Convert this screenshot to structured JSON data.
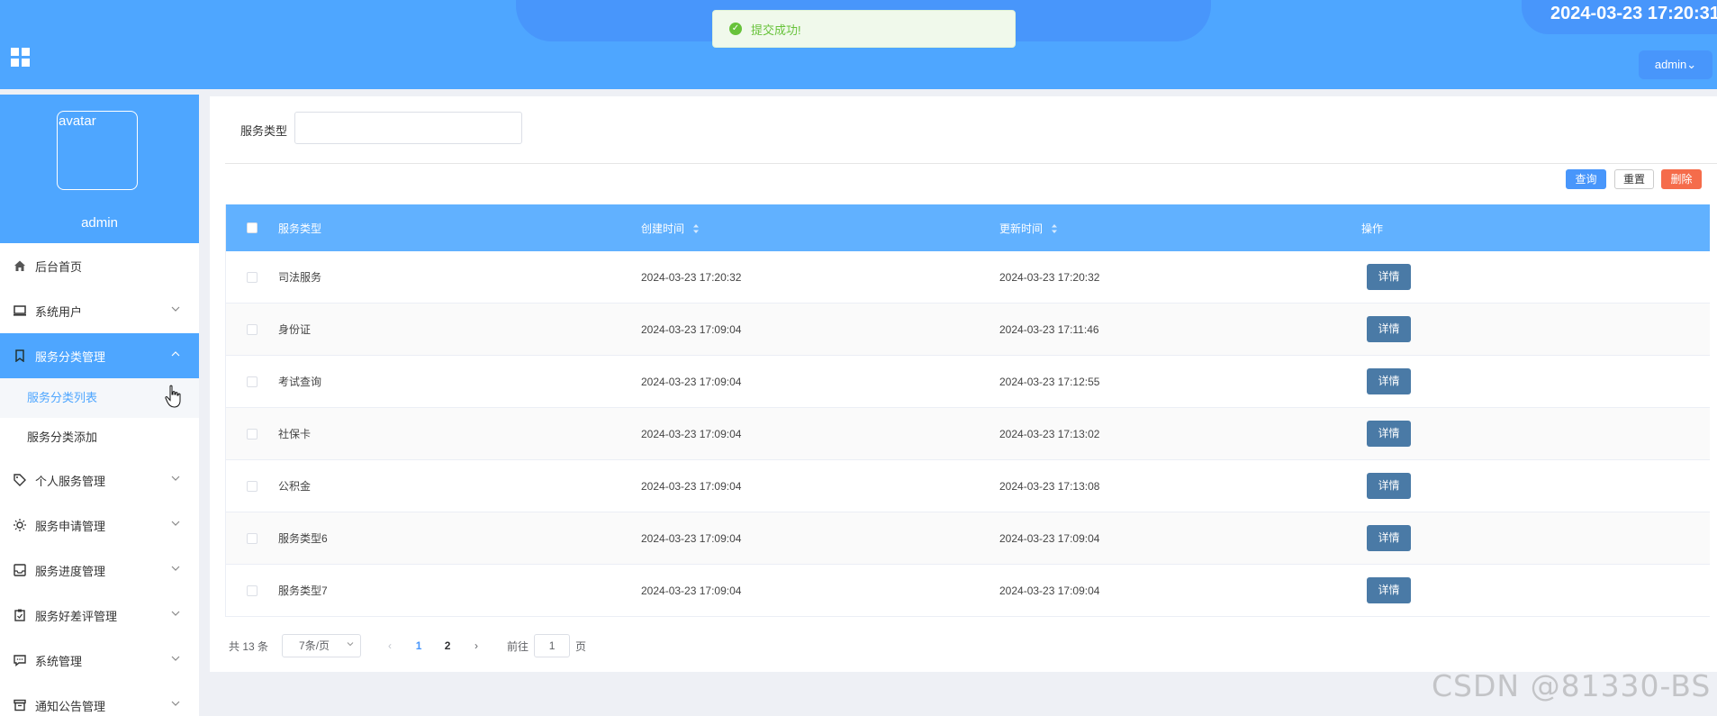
{
  "header": {
    "datetime": "2024-03-23 17:20:31",
    "user_menu": "admin⌄"
  },
  "toast": {
    "message": "提交成功!"
  },
  "sidebar": {
    "avatar_alt": "avatar",
    "username": "admin",
    "items": [
      {
        "label": "后台首页",
        "icon": "home-icon"
      },
      {
        "label": "系统用户",
        "icon": "monitor-icon"
      },
      {
        "label": "服务分类管理",
        "icon": "bookmark-icon"
      },
      {
        "label": "服务分类列表"
      },
      {
        "label": "服务分类添加"
      },
      {
        "label": "个人服务管理",
        "icon": "tag-icon"
      },
      {
        "label": "服务申请管理",
        "icon": "sun-icon"
      },
      {
        "label": "服务进度管理",
        "icon": "inbox-icon"
      },
      {
        "label": "服务好差评管理",
        "icon": "clipboard-icon"
      },
      {
        "label": "系统管理",
        "icon": "chat-icon"
      },
      {
        "label": "通知公告管理",
        "icon": "archive-icon"
      }
    ]
  },
  "search": {
    "label": "服务类型",
    "value": ""
  },
  "toolbar": {
    "query": "查询",
    "reset": "重置",
    "delete": "删除"
  },
  "table": {
    "headers": [
      "服务类型",
      "创建时间",
      "更新时间",
      "操作"
    ],
    "detail_label": "详情",
    "rows": [
      {
        "type": "司法服务",
        "created": "2024-03-23 17:20:32",
        "updated": "2024-03-23 17:20:32"
      },
      {
        "type": "身份证",
        "created": "2024-03-23 17:09:04",
        "updated": "2024-03-23 17:11:46"
      },
      {
        "type": "考试查询",
        "created": "2024-03-23 17:09:04",
        "updated": "2024-03-23 17:12:55"
      },
      {
        "type": "社保卡",
        "created": "2024-03-23 17:09:04",
        "updated": "2024-03-23 17:13:02"
      },
      {
        "type": "公积金",
        "created": "2024-03-23 17:09:04",
        "updated": "2024-03-23 17:13:08"
      },
      {
        "type": "服务类型6",
        "created": "2024-03-23 17:09:04",
        "updated": "2024-03-23 17:09:04"
      },
      {
        "type": "服务类型7",
        "created": "2024-03-23 17:09:04",
        "updated": "2024-03-23 17:09:04"
      }
    ]
  },
  "pagination": {
    "total": "共 13 条",
    "page_size": "7条/页",
    "pages": [
      "1",
      "2"
    ],
    "current_page": "1",
    "goto_prefix": "前往",
    "goto_value": "1",
    "goto_suffix": "页"
  },
  "watermark": "CSDN @81330-BS",
  "colors": {
    "header": "#4ea6ff",
    "accent": "#4896fb",
    "table_header": "#61b1ff",
    "detail_button": "#4a7aa6",
    "delete_button": "#f56c4b",
    "success": "#67c23a"
  }
}
